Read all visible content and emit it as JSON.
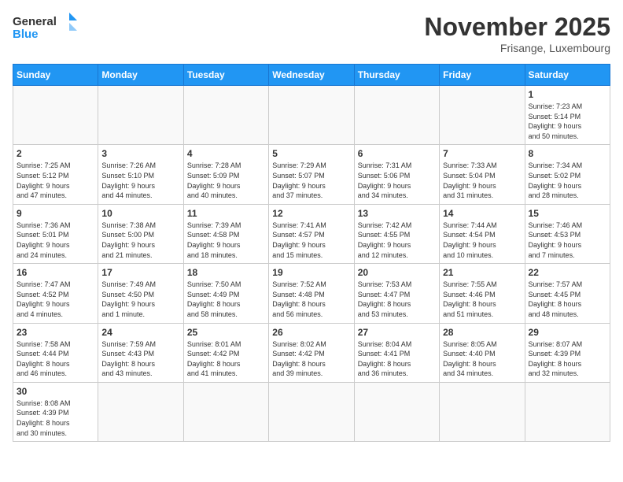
{
  "header": {
    "logo_general": "General",
    "logo_blue": "Blue",
    "month_title": "November 2025",
    "location": "Frisange, Luxembourg"
  },
  "days_of_week": [
    "Sunday",
    "Monday",
    "Tuesday",
    "Wednesday",
    "Thursday",
    "Friday",
    "Saturday"
  ],
  "weeks": [
    [
      {
        "day": "",
        "info": ""
      },
      {
        "day": "",
        "info": ""
      },
      {
        "day": "",
        "info": ""
      },
      {
        "day": "",
        "info": ""
      },
      {
        "day": "",
        "info": ""
      },
      {
        "day": "",
        "info": ""
      },
      {
        "day": "1",
        "info": "Sunrise: 7:23 AM\nSunset: 5:14 PM\nDaylight: 9 hours\nand 50 minutes."
      }
    ],
    [
      {
        "day": "2",
        "info": "Sunrise: 7:25 AM\nSunset: 5:12 PM\nDaylight: 9 hours\nand 47 minutes."
      },
      {
        "day": "3",
        "info": "Sunrise: 7:26 AM\nSunset: 5:10 PM\nDaylight: 9 hours\nand 44 minutes."
      },
      {
        "day": "4",
        "info": "Sunrise: 7:28 AM\nSunset: 5:09 PM\nDaylight: 9 hours\nand 40 minutes."
      },
      {
        "day": "5",
        "info": "Sunrise: 7:29 AM\nSunset: 5:07 PM\nDaylight: 9 hours\nand 37 minutes."
      },
      {
        "day": "6",
        "info": "Sunrise: 7:31 AM\nSunset: 5:06 PM\nDaylight: 9 hours\nand 34 minutes."
      },
      {
        "day": "7",
        "info": "Sunrise: 7:33 AM\nSunset: 5:04 PM\nDaylight: 9 hours\nand 31 minutes."
      },
      {
        "day": "8",
        "info": "Sunrise: 7:34 AM\nSunset: 5:02 PM\nDaylight: 9 hours\nand 28 minutes."
      }
    ],
    [
      {
        "day": "9",
        "info": "Sunrise: 7:36 AM\nSunset: 5:01 PM\nDaylight: 9 hours\nand 24 minutes."
      },
      {
        "day": "10",
        "info": "Sunrise: 7:38 AM\nSunset: 5:00 PM\nDaylight: 9 hours\nand 21 minutes."
      },
      {
        "day": "11",
        "info": "Sunrise: 7:39 AM\nSunset: 4:58 PM\nDaylight: 9 hours\nand 18 minutes."
      },
      {
        "day": "12",
        "info": "Sunrise: 7:41 AM\nSunset: 4:57 PM\nDaylight: 9 hours\nand 15 minutes."
      },
      {
        "day": "13",
        "info": "Sunrise: 7:42 AM\nSunset: 4:55 PM\nDaylight: 9 hours\nand 12 minutes."
      },
      {
        "day": "14",
        "info": "Sunrise: 7:44 AM\nSunset: 4:54 PM\nDaylight: 9 hours\nand 10 minutes."
      },
      {
        "day": "15",
        "info": "Sunrise: 7:46 AM\nSunset: 4:53 PM\nDaylight: 9 hours\nand 7 minutes."
      }
    ],
    [
      {
        "day": "16",
        "info": "Sunrise: 7:47 AM\nSunset: 4:52 PM\nDaylight: 9 hours\nand 4 minutes."
      },
      {
        "day": "17",
        "info": "Sunrise: 7:49 AM\nSunset: 4:50 PM\nDaylight: 9 hours\nand 1 minute."
      },
      {
        "day": "18",
        "info": "Sunrise: 7:50 AM\nSunset: 4:49 PM\nDaylight: 8 hours\nand 58 minutes."
      },
      {
        "day": "19",
        "info": "Sunrise: 7:52 AM\nSunset: 4:48 PM\nDaylight: 8 hours\nand 56 minutes."
      },
      {
        "day": "20",
        "info": "Sunrise: 7:53 AM\nSunset: 4:47 PM\nDaylight: 8 hours\nand 53 minutes."
      },
      {
        "day": "21",
        "info": "Sunrise: 7:55 AM\nSunset: 4:46 PM\nDaylight: 8 hours\nand 51 minutes."
      },
      {
        "day": "22",
        "info": "Sunrise: 7:57 AM\nSunset: 4:45 PM\nDaylight: 8 hours\nand 48 minutes."
      }
    ],
    [
      {
        "day": "23",
        "info": "Sunrise: 7:58 AM\nSunset: 4:44 PM\nDaylight: 8 hours\nand 46 minutes."
      },
      {
        "day": "24",
        "info": "Sunrise: 7:59 AM\nSunset: 4:43 PM\nDaylight: 8 hours\nand 43 minutes."
      },
      {
        "day": "25",
        "info": "Sunrise: 8:01 AM\nSunset: 4:42 PM\nDaylight: 8 hours\nand 41 minutes."
      },
      {
        "day": "26",
        "info": "Sunrise: 8:02 AM\nSunset: 4:42 PM\nDaylight: 8 hours\nand 39 minutes."
      },
      {
        "day": "27",
        "info": "Sunrise: 8:04 AM\nSunset: 4:41 PM\nDaylight: 8 hours\nand 36 minutes."
      },
      {
        "day": "28",
        "info": "Sunrise: 8:05 AM\nSunset: 4:40 PM\nDaylight: 8 hours\nand 34 minutes."
      },
      {
        "day": "29",
        "info": "Sunrise: 8:07 AM\nSunset: 4:39 PM\nDaylight: 8 hours\nand 32 minutes."
      }
    ],
    [
      {
        "day": "30",
        "info": "Sunrise: 8:08 AM\nSunset: 4:39 PM\nDaylight: 8 hours\nand 30 minutes."
      },
      {
        "day": "",
        "info": ""
      },
      {
        "day": "",
        "info": ""
      },
      {
        "day": "",
        "info": ""
      },
      {
        "day": "",
        "info": ""
      },
      {
        "day": "",
        "info": ""
      },
      {
        "day": "",
        "info": ""
      }
    ]
  ]
}
